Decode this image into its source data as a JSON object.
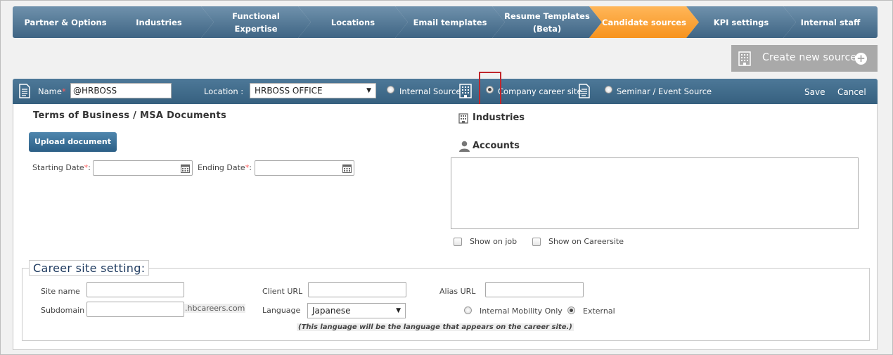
{
  "steps": [
    {
      "label": "Partner & Options"
    },
    {
      "label": "Industries"
    },
    {
      "label": "Functional Expertise"
    },
    {
      "label": "Locations"
    },
    {
      "label": "Email templates"
    },
    {
      "label": "Resume Templates (Beta)"
    },
    {
      "label": "Candidate sources",
      "active": true
    },
    {
      "label": "KPI settings"
    },
    {
      "label": "Internal staff"
    }
  ],
  "create_button": {
    "label": "Create new source"
  },
  "header": {
    "name_label": "Name",
    "name_value": "@HRBOSS",
    "location_label": "Location :",
    "location_value": "HRBOSS OFFICE",
    "source_types": {
      "internal": "Internal Source",
      "career": "Company career site",
      "seminar": "Seminar / Event Source"
    },
    "selected_source": "career",
    "save": "Save",
    "cancel": "Cancel"
  },
  "terms": {
    "title": "Terms of Business / MSA Documents",
    "upload": "Upload document",
    "start_label": "Starting Date",
    "end_label": "Ending Date",
    "required_mark": "*",
    "colon": ":"
  },
  "industries": {
    "title": "Industries"
  },
  "accounts": {
    "title": "Accounts"
  },
  "options": {
    "show_on_job": "Show on job",
    "show_on_careersite": "Show on Careersite"
  },
  "career_site": {
    "legend": "Career site setting:",
    "site_name_label": "Site name",
    "subdomain_label": "Subdomain",
    "subdomain_suffix": ".hbcareers.com",
    "client_url_label": "Client URL",
    "language_label": "Language",
    "language_value": "Japanese",
    "alias_url_label": "Alias URL",
    "mobility_internal": "Internal Mobility Only",
    "mobility_external": "External",
    "mobility_selected": "External",
    "language_note": "(This language will be the language that appears on the career site.)"
  },
  "colors": {
    "step_bg": "#4f7593",
    "step_active": "#f7931e",
    "header_bg": "#3f6584",
    "button_bg": "#2c5f86",
    "highlight": "#c0262c"
  }
}
